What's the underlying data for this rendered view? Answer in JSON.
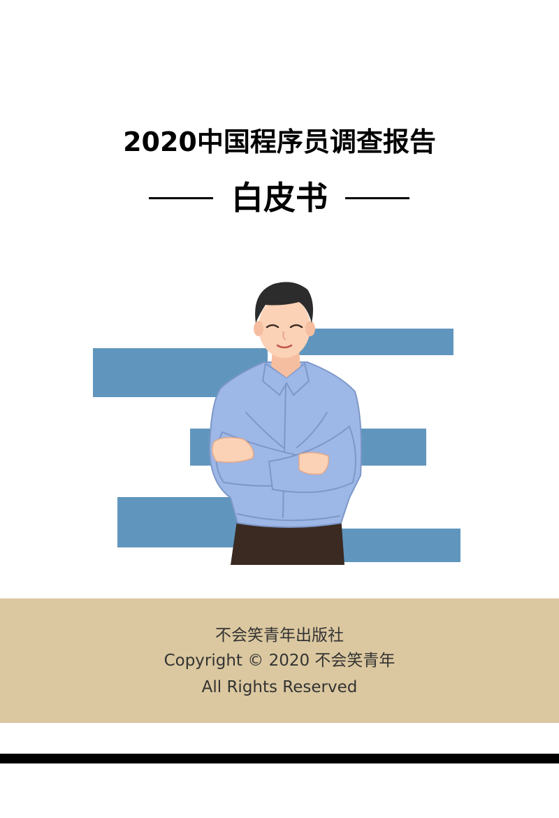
{
  "cover": {
    "title": "2020中国程序员调查报告",
    "subtitle": "白皮书"
  },
  "illustration": {
    "subject": "programmer-arms-crossed",
    "colors": {
      "bars": "#6096bd",
      "shirt": "#9db7e6",
      "pants": "#3a2a22",
      "skin": "#fcd2b6",
      "hair": "#2c2c2c"
    }
  },
  "footer": {
    "publisher": "不会笑青年出版社",
    "copyright": "Copyright © 2020 不会笑青年",
    "rights": "All Rights Reserved",
    "band_color": "#dbc8a0"
  }
}
